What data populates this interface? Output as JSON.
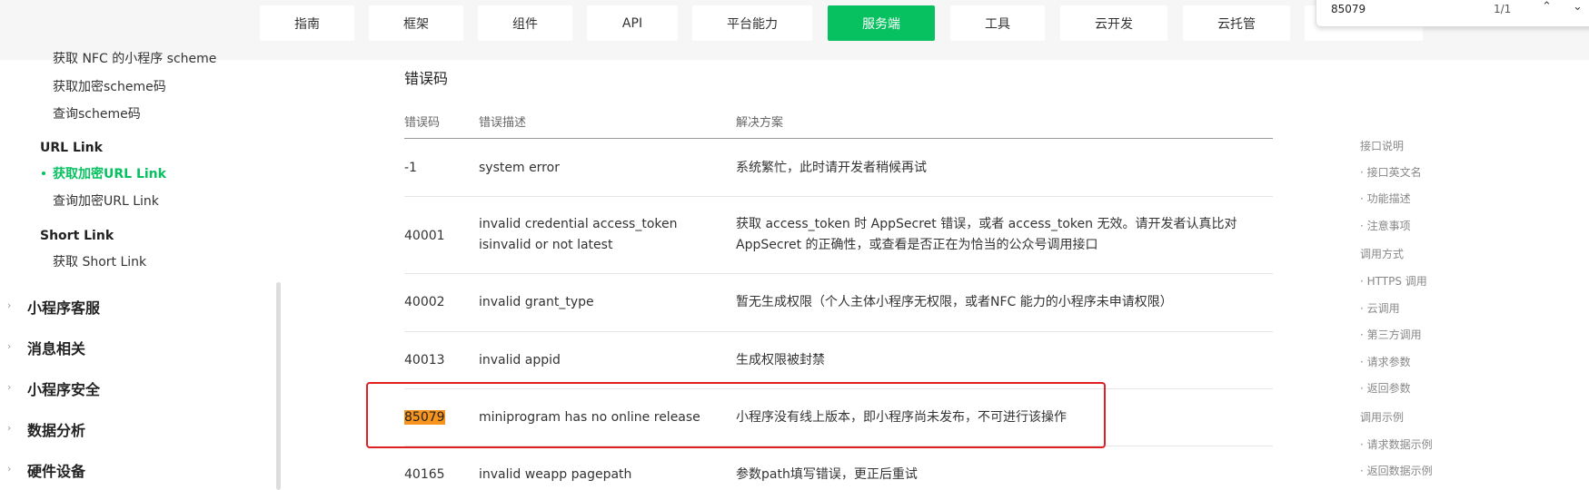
{
  "nav": {
    "tabs": [
      {
        "label": "指南"
      },
      {
        "label": "框架"
      },
      {
        "label": "组件"
      },
      {
        "label": "API"
      },
      {
        "label": "平台能力"
      },
      {
        "label": "服务端"
      },
      {
        "label": "工具"
      },
      {
        "label": "云开发"
      },
      {
        "label": "云托管"
      }
    ]
  },
  "find": {
    "query": "85079",
    "count": "1/1",
    "up_icon": "chevron-up-icon",
    "down_icon": "chevron-down-icon"
  },
  "sidebar": {
    "items": [
      {
        "label": "获取 NFC 的小程序 scheme"
      },
      {
        "label": "获取加密scheme码"
      },
      {
        "label": "查询scheme码"
      },
      {
        "label": "URL Link"
      },
      {
        "label": "获取加密URL Link"
      },
      {
        "label": "查询加密URL Link"
      },
      {
        "label": "Short Link"
      },
      {
        "label": "获取 Short Link"
      }
    ],
    "categories": [
      {
        "label": "小程序客服"
      },
      {
        "label": "消息相关"
      },
      {
        "label": "小程序安全"
      },
      {
        "label": "数据分析"
      },
      {
        "label": "硬件设备"
      }
    ]
  },
  "main": {
    "section_title": "错误码",
    "headers": [
      "错误码",
      "错误描述",
      "解决方案"
    ],
    "rows": [
      {
        "code": "-1",
        "desc": "system error",
        "sol": "系统繁忙，此时请开发者稍候再试"
      },
      {
        "code": "40001",
        "desc": "invalid credential  access_token isinvalid or not latest",
        "sol": "获取 access_token 时 AppSecret 错误，或者 access_token 无效。请开发者认真比对 AppSecret 的正确性，或查看是否正在为恰当的公众号调用接口"
      },
      {
        "code": "40002",
        "desc": "invalid grant_type",
        "sol": "暂无生成权限（个人主体小程序无权限，或者NFC 能力的小程序未申请权限）"
      },
      {
        "code": "40013",
        "desc": "invalid appid",
        "sol": "生成权限被封禁"
      },
      {
        "code": "85079",
        "desc": "miniprogram has no online release",
        "sol": "小程序没有线上版本，即小程序尚未发布，不可进行该操作"
      },
      {
        "code": "40165",
        "desc": "invalid weapp pagepath",
        "sol": "参数path填写错误，更正后重试"
      }
    ]
  },
  "toc": {
    "items": [
      {
        "label": "接口说明"
      },
      {
        "label": "· 接口英文名"
      },
      {
        "label": "· 功能描述"
      },
      {
        "label": "· 注意事项"
      },
      {
        "label": "调用方式"
      },
      {
        "label": "· HTTPS 调用"
      },
      {
        "label": "· 云调用"
      },
      {
        "label": "· 第三方调用"
      },
      {
        "label": "· 请求参数"
      },
      {
        "label": "· 返回参数"
      },
      {
        "label": "调用示例"
      },
      {
        "label": "· 请求数据示例"
      },
      {
        "label": "· 返回数据示例"
      }
    ]
  },
  "colors": {
    "accent": "#07c160",
    "highlight": "#f7941d",
    "annotation": "#e02020"
  }
}
